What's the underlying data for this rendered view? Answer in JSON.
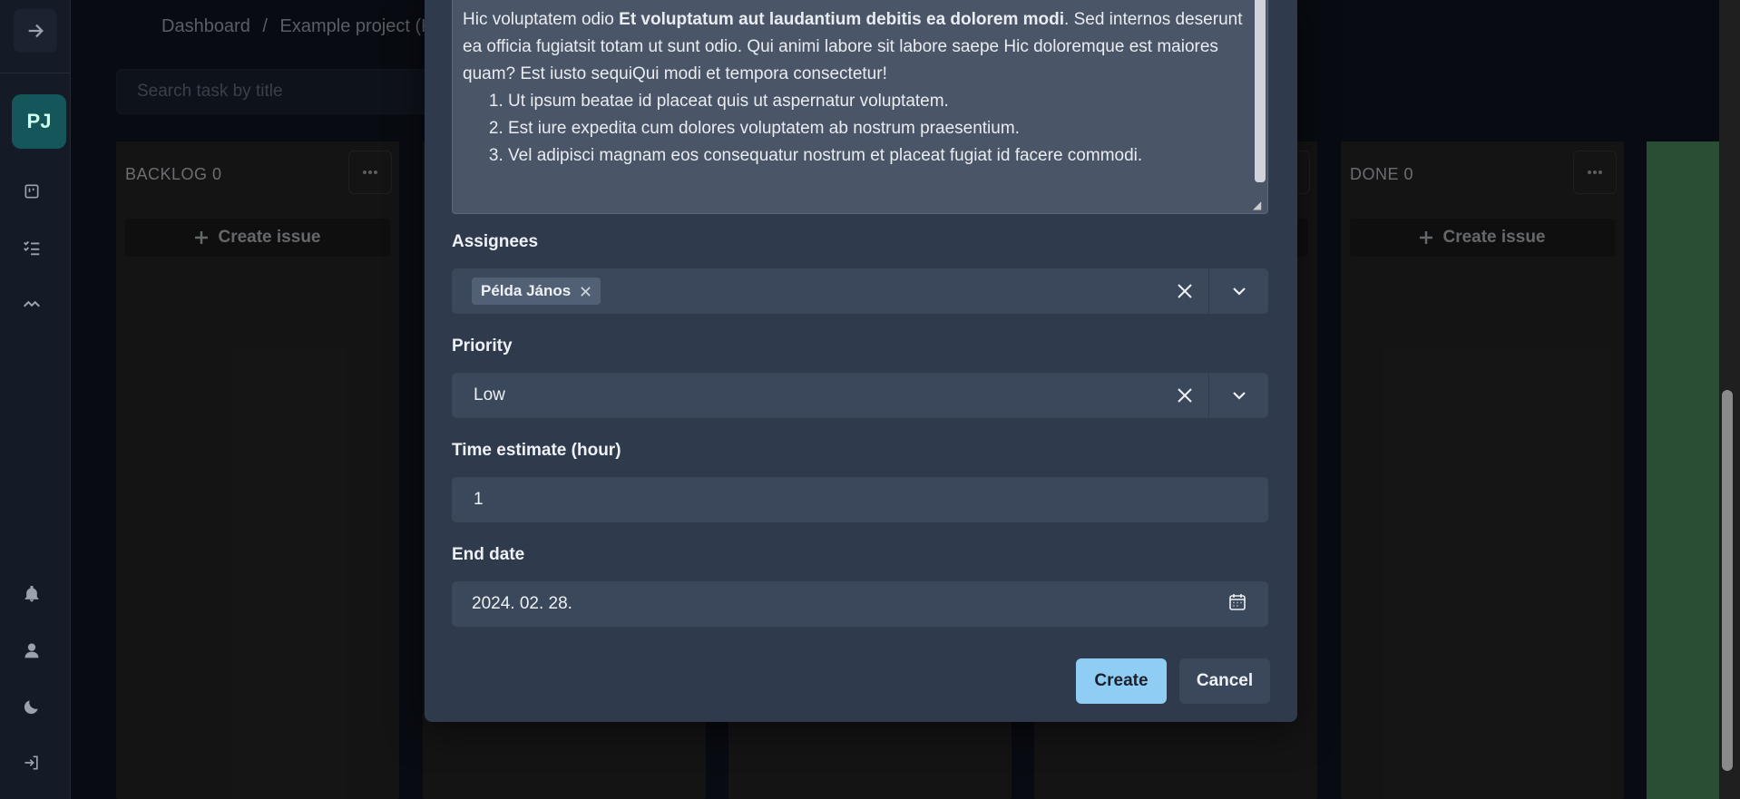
{
  "breadcrumb": {
    "home": "Dashboard",
    "sep": "/",
    "project": "Example project (Ka"
  },
  "search": {
    "placeholder": "Search task by title"
  },
  "sidebar": {
    "avatar": "PJ"
  },
  "columns": [
    {
      "title": "BACKLOG  0",
      "create": "Create issue"
    },
    {
      "title": "",
      "create": ""
    },
    {
      "title": "",
      "create": ""
    },
    {
      "title": "",
      "create": ""
    },
    {
      "title": "DONE  0",
      "create": "Create issue"
    }
  ],
  "modal": {
    "description": {
      "p1_start": "Hic voluptatem odio ",
      "p1_bold": "Et voluptatum aut laudantium debitis ea dolorem modi",
      "p1_end": ". Sed internos deserunt ea officia fugiatsit totam ut sunt odio. Qui animi labore sit labore saepe Hic doloremque est maiores quam? Est iusto sequiQui modi et tempora consectetur!",
      "list": [
        "Ut ipsum beatae id placeat quis ut aspernatur voluptatem.",
        "Est iure expedita cum dolores voluptatem ab nostrum praesentium.",
        "Vel adipisci magnam eos consequatur nostrum et placeat fugiat id facere commodi."
      ]
    },
    "assignees": {
      "label": "Assignees",
      "chip": "Példa János"
    },
    "priority": {
      "label": "Priority",
      "value": "Low"
    },
    "time_estimate": {
      "label": "Time estimate (hour)",
      "value": "1"
    },
    "end_date": {
      "label": "End date",
      "value": "2024. 02. 28."
    },
    "buttons": {
      "create": "Create",
      "cancel": "Cancel"
    }
  }
}
